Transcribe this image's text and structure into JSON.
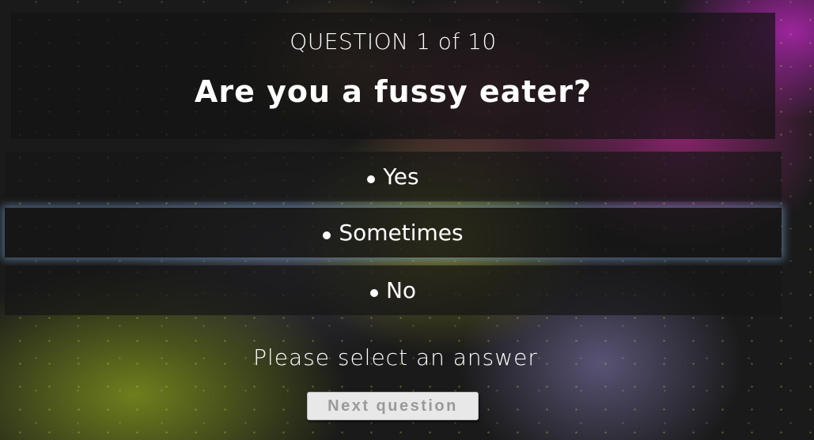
{
  "quiz": {
    "counter": "QUESTION 1 of 10",
    "question": "Are you a fussy eater?",
    "answers": [
      {
        "label": "Yes"
      },
      {
        "label": "Sometimes"
      },
      {
        "label": "No"
      }
    ],
    "prompt": "Please select an answer",
    "next_label": "Next question"
  }
}
